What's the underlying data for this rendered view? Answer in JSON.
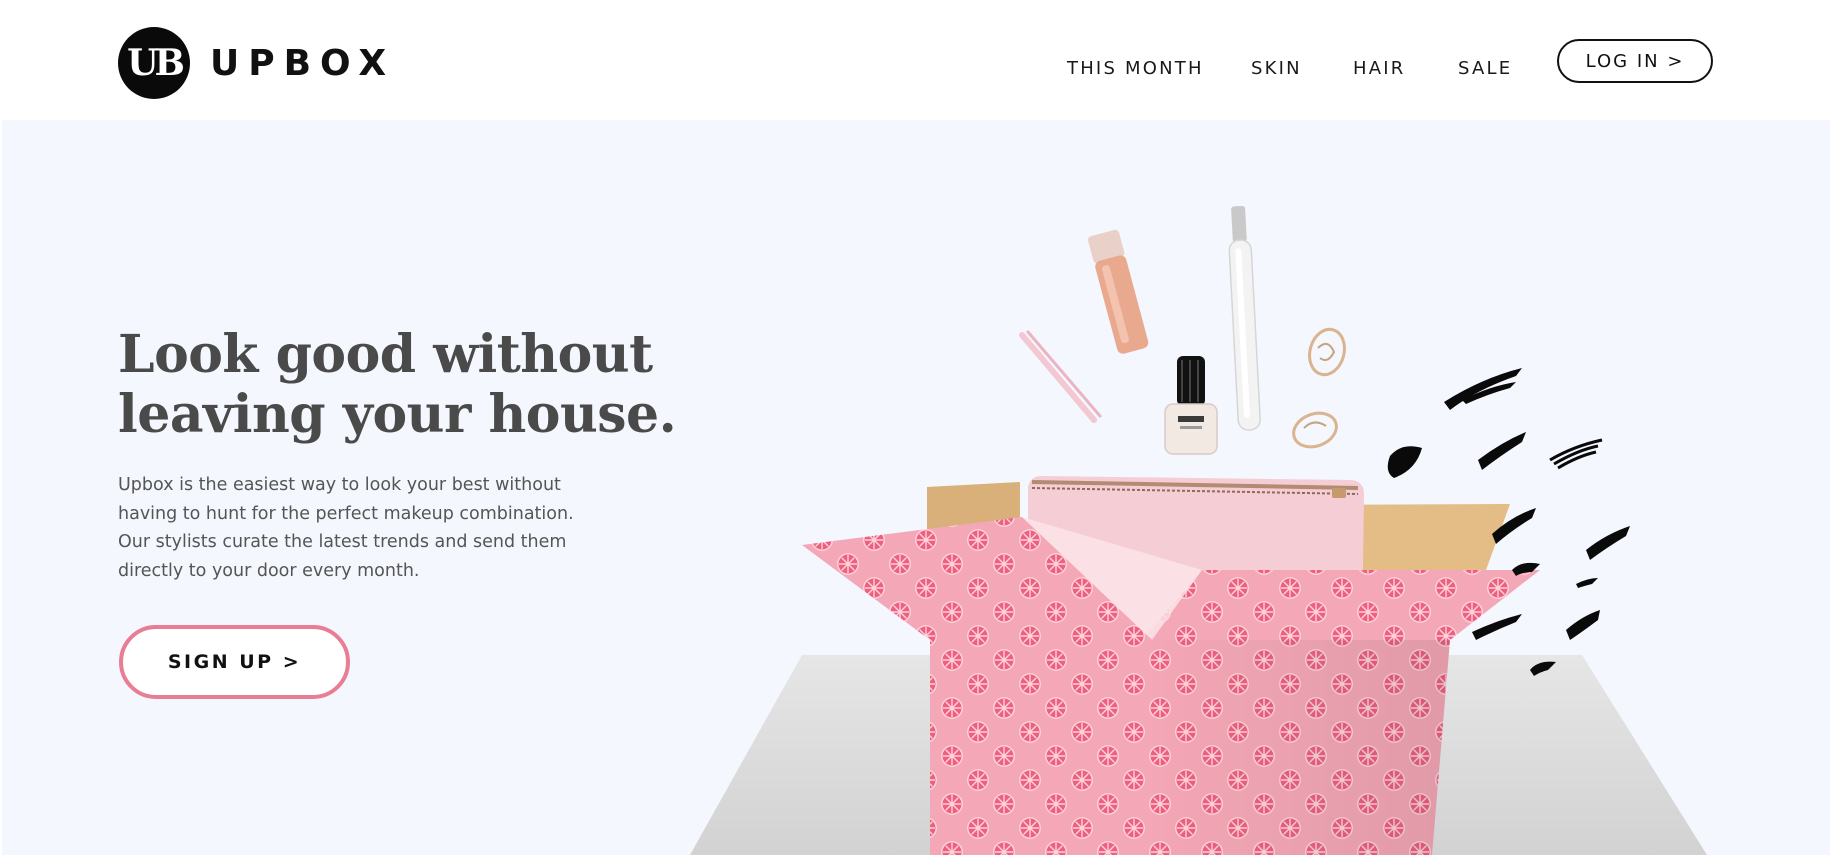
{
  "brand": {
    "logo_mark": "UB",
    "name": "UPBOX"
  },
  "nav": {
    "items": [
      "THIS MONTH",
      "SKIN",
      "HAIR",
      "SALE"
    ],
    "login_label": "LOG IN >"
  },
  "hero": {
    "headline": [
      "Look good without",
      "leaving your house."
    ],
    "body": [
      "Upbox is the easiest way to look your best without",
      "having to hunt for the perfect makeup combination.",
      "Our stylists curate the latest trends and send them",
      "directly to your door every month."
    ],
    "signup_label": "SIGN UP >",
    "image_items": [
      "tweezers-icon",
      "lip-gloss-icon",
      "nail-polish-icon",
      "perfume-vial-icon",
      "earring-icon",
      "makeup-pouch-icon",
      "gift-box-icon",
      "brush-stroke-icon"
    ]
  },
  "colors": {
    "accent_pink": "#e97d93",
    "hero_background": "#f4f7fd",
    "headline_text": "#4a4a4a",
    "stripe_pink": "#f06f9a",
    "stripe_violet": "#8f6ff0",
    "box_pink": "#f4a7b6",
    "grapefruit": "#f05f7e"
  }
}
